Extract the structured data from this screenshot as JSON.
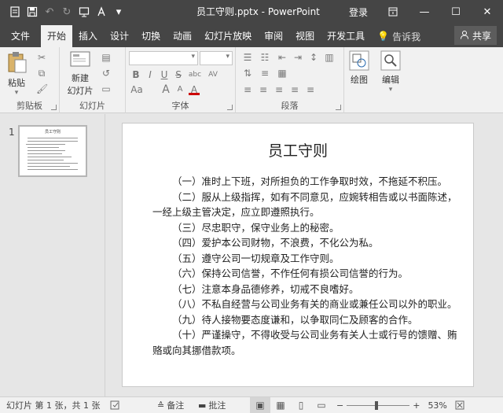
{
  "window": {
    "title": "员工守则.pptx - PowerPoint",
    "login": "登录",
    "minimize": "—",
    "maximize": "☐",
    "close": "✕"
  },
  "qat": {
    "save": "💾",
    "undo": "↶",
    "redo": "↻",
    "more": "▾"
  },
  "tabs": [
    {
      "label": "文件"
    },
    {
      "label": "开始"
    },
    {
      "label": "插入"
    },
    {
      "label": "设计"
    },
    {
      "label": "切换"
    },
    {
      "label": "动画"
    },
    {
      "label": "幻灯片放映"
    },
    {
      "label": "审阅"
    },
    {
      "label": "视图"
    },
    {
      "label": "开发工具"
    }
  ],
  "tell_me": "告诉我",
  "share": "共享",
  "ribbon": {
    "clipboard": {
      "paste": "粘贴",
      "label": "剪贴板"
    },
    "slides": {
      "new_slide_line1": "新建",
      "new_slide_line2": "幻灯片",
      "label": "幻灯片"
    },
    "font": {
      "label": "字体",
      "bold": "B",
      "italic": "I",
      "underline": "U",
      "strike": "S",
      "shadow": "abc",
      "spacing": "AV",
      "case": "Aa",
      "color": "A",
      "grow": "A",
      "shrink": "A"
    },
    "paragraph": {
      "label": "段落"
    },
    "drawing": {
      "label": "绘图"
    },
    "editing": {
      "label": "编辑"
    }
  },
  "thumbnail": {
    "number": "1",
    "title": "员工守则"
  },
  "slide": {
    "title": "员工守则",
    "lines": [
      "（一）准时上下班，对所担负的工作争取时效，不拖延不积压。",
      "（二）服从上级指挥，如有不同意见，应婉转相告或以书面陈述，一经上级主管决定，应立即遵照执行。",
      "（三）尽忠职守，保守业务上的秘密。",
      "（四）爱护本公司财物，不浪费，不化公为私。",
      "（五）遵守公司一切规章及工作守则。",
      "（六）保持公司信誉，不作任何有损公司信誉的行为。",
      "（七）注意本身品德修养，切戒不良嗜好。",
      "（八）不私自经营与公司业务有关的商业或兼任公司以外的职业。",
      "（九）待人接物要态度谦和，以争取同仁及顾客的合作。",
      "（十）严谨操守，不得收受与公司业务有关人士或行号的馈赠、贿赂或向其挪借款项。"
    ]
  },
  "status": {
    "slide_info": "幻灯片 第 1 张，共 1 张",
    "notes": "备注",
    "comments": "批注",
    "zoom_minus": "−",
    "zoom_plus": "+",
    "zoom": "53%"
  }
}
